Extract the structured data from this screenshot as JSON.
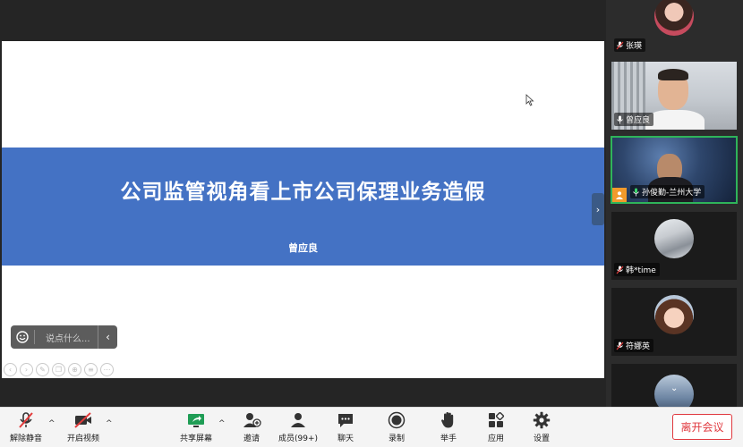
{
  "slide": {
    "title": "公司监管视角看上市公司保理业务造假",
    "author": "曾应良"
  },
  "chat": {
    "emoji_icon": "smiley-icon",
    "placeholder": "说点什么...",
    "collapse_icon": "chevron-left-icon"
  },
  "panel_toggle_icon": "chevron-right-icon",
  "participants": [
    {
      "name": "张瑛",
      "muted": true
    },
    {
      "name": "曾应良",
      "muted": false
    },
    {
      "name": "孙俊勤-兰州大学",
      "muted": false,
      "speaking": true
    },
    {
      "name": "韩*time",
      "muted": true
    },
    {
      "name": "符娜英",
      "muted": true
    }
  ],
  "participants_more_icon": "chevron-down-icon",
  "toolbar": {
    "unmute": "解除静音",
    "start_video": "开启视频",
    "share_screen": "共享屏幕",
    "invite": "邀请",
    "members": "成员(99+)",
    "chat": "聊天",
    "record": "录制",
    "raise_hand": "举手",
    "apps": "应用",
    "settings": "设置",
    "leave": "离开会议"
  },
  "colors": {
    "slide_band": "#4472c4",
    "speaking_border": "#2fb45a",
    "leave_red": "#e0383e",
    "share_green": "#1f9d55"
  }
}
